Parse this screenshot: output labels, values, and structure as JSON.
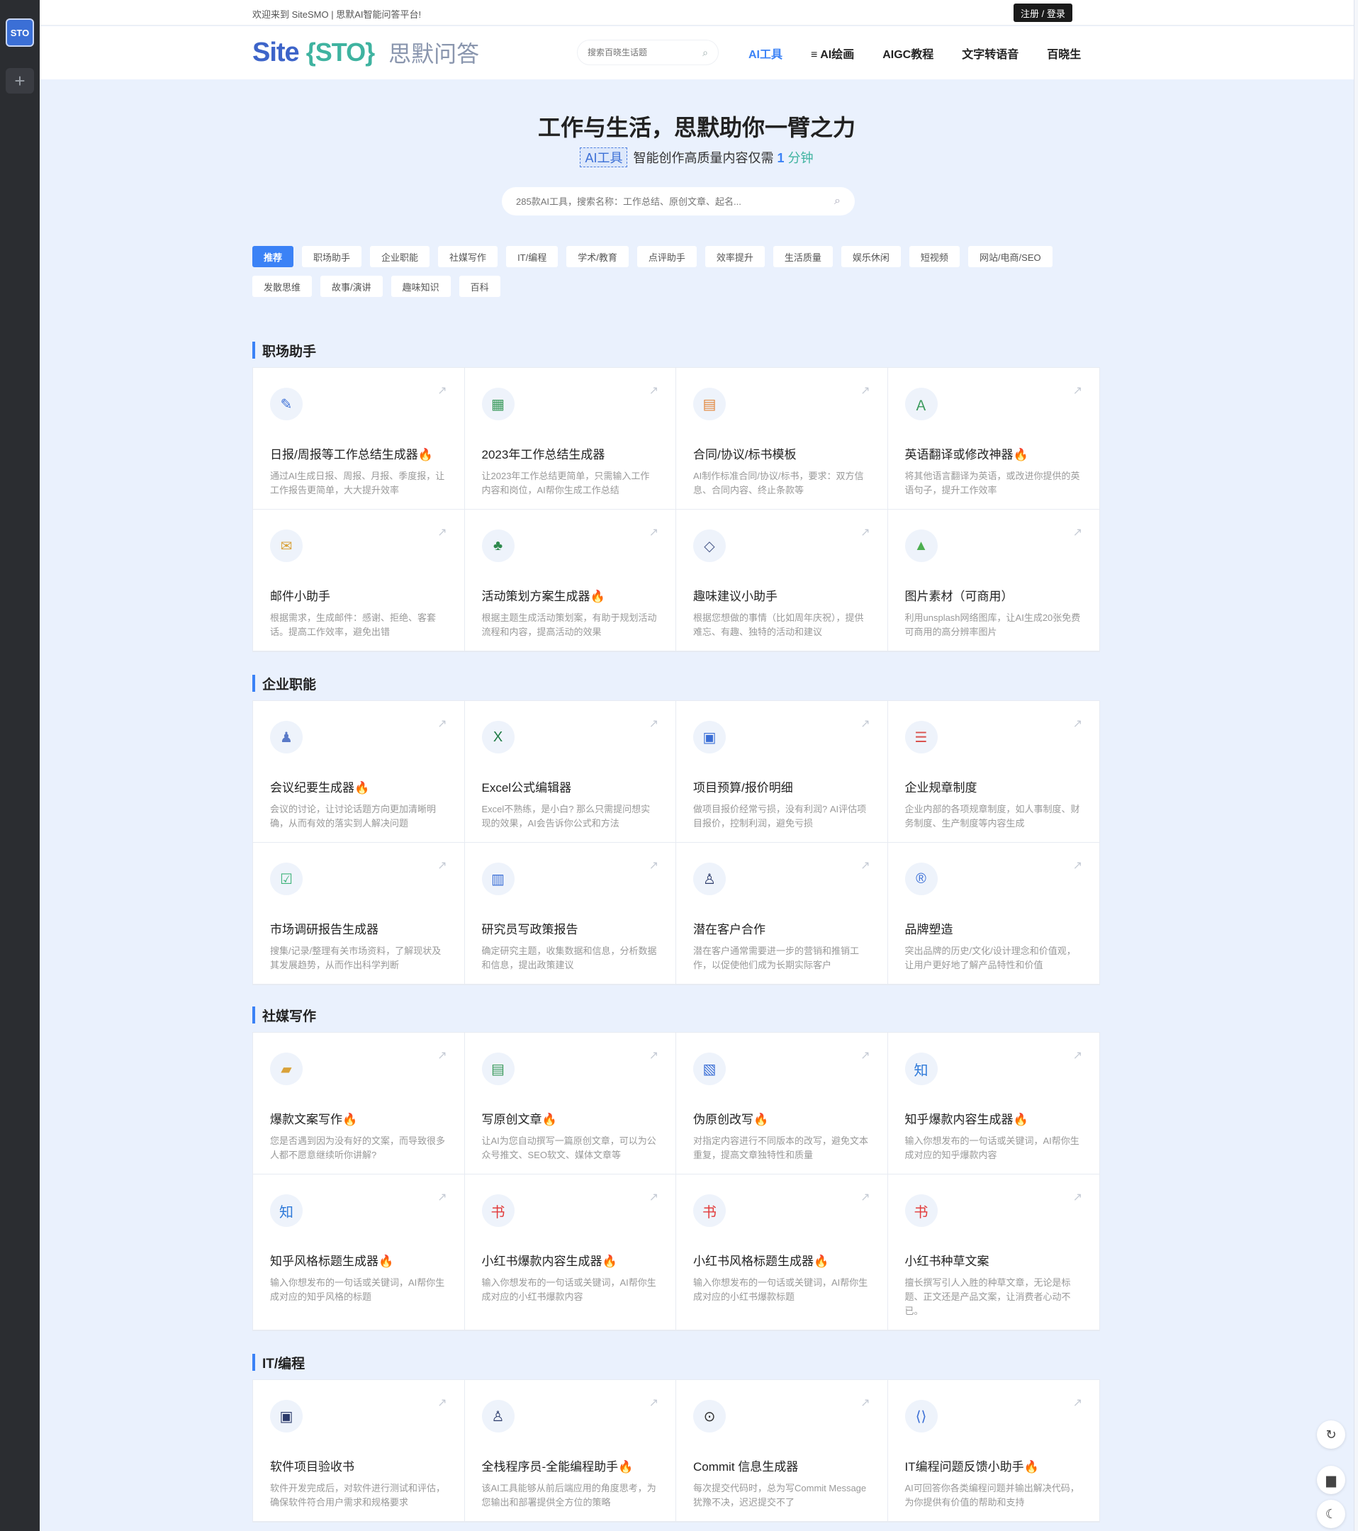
{
  "rail": {
    "logo_text": "STO",
    "add_icon": "plus-icon"
  },
  "topbar": {
    "welcome": "欢迎来到 SiteSMO | 思默AI智能问答平台!",
    "login": "注册 / 登录"
  },
  "header": {
    "logo_site": "Site",
    "logo_sto": "{STO}",
    "logo_cn": "思默问答",
    "search_placeholder": "搜索百晓生话题",
    "nav": [
      {
        "label": "AI工具",
        "active": true
      },
      {
        "label": "≡ AI绘画",
        "active": false
      },
      {
        "label": "AIGC教程",
        "active": false
      },
      {
        "label": "文字转语音",
        "active": false
      },
      {
        "label": "百晓生",
        "active": false
      }
    ]
  },
  "hero": {
    "title": "工作与生活，思默助你一臂之力",
    "tag": "AI工具",
    "sub_text": "智能创作高质量内容仅需",
    "sub_num": "1",
    "sub_unit": "分钟",
    "search_placeholder": "285款AI工具，搜索名称：工作总结、原创文章、起名..."
  },
  "chips": [
    "推荐",
    "职场助手",
    "企业职能",
    "社媒写作",
    "IT/编程",
    "学术/教育",
    "点评助手",
    "效率提升",
    "生活质量",
    "娱乐休闲",
    "短视频",
    "网站/电商/SEO",
    "发散思维",
    "故事/演讲",
    "趣味知识",
    "百科"
  ],
  "sections": [
    {
      "title": "职场助手",
      "cards": [
        {
          "icon": "edit-icon",
          "glyph": "✎",
          "color": "#3b6fd6",
          "title": "日报/周报等工作总结生成器",
          "hot": true,
          "desc": "通过AI生成日报、周报、月报、季度报，让工作报告更简单，大大提升效率"
        },
        {
          "icon": "calendar-icon",
          "glyph": "▦",
          "color": "#3a9a5b",
          "title": "2023年工作总结生成器",
          "hot": false,
          "desc": "让2023年工作总结更简单，只需输入工作内容和岗位，AI帮你生成工作总结"
        },
        {
          "icon": "contract-icon",
          "glyph": "▤",
          "color": "#e2853a",
          "title": "合同/协议/标书模板",
          "hot": false,
          "desc": "AI制作标准合同/协议/标书，要求：双方信息、合同内容、终止条款等"
        },
        {
          "icon": "translate-icon",
          "glyph": "Ａ",
          "color": "#3a9a5b",
          "title": "英语翻译或修改神器",
          "hot": true,
          "desc": "将其他语言翻译为英语，或改进你提供的英语句子，提升工作效率"
        },
        {
          "icon": "mail-icon",
          "glyph": "✉",
          "color": "#d9a23a",
          "title": "邮件小助手",
          "hot": false,
          "desc": "根据需求，生成邮件：感谢、拒绝、客套话。提高工作效率，避免出错"
        },
        {
          "icon": "tree-icon",
          "glyph": "♣",
          "color": "#2f8a4e",
          "title": "活动策划方案生成器",
          "hot": true,
          "desc": "根据主题生成活动策划案，有助于规划活动流程和内容，提高活动的效果"
        },
        {
          "icon": "eraser-icon",
          "glyph": "◇",
          "color": "#4a5a8a",
          "title": "趣味建议小助手",
          "hot": false,
          "desc": "根据您想做的事情（比如周年庆祝），提供难忘、有趣、独特的活动和建议"
        },
        {
          "icon": "image-icon",
          "glyph": "▲",
          "color": "#4caf50",
          "title": "图片素材（可商用）",
          "hot": false,
          "desc": "利用unsplash网络图库，让AI生成20张免费可商用的高分辨率图片"
        }
      ]
    },
    {
      "title": "企业职能",
      "cards": [
        {
          "icon": "meeting-icon",
          "glyph": "♟",
          "color": "#5a7ac8",
          "title": "会议纪要生成器",
          "hot": true,
          "desc": "会议的讨论，让讨论话题方向更加清晰明确，从而有效的落实到人解决问题"
        },
        {
          "icon": "excel-icon",
          "glyph": "X",
          "color": "#1e7a45",
          "title": "Excel公式编辑器",
          "hot": false,
          "desc": "Excel不熟练，是小白? 那么只需提问想实现的效果，AI会告诉你公式和方法"
        },
        {
          "icon": "budget-icon",
          "glyph": "▣",
          "color": "#3b6fd6",
          "title": "项目预算/报价明细",
          "hot": false,
          "desc": "做项目报价经常亏损，没有利润? AI评估项目报价，控制利润，避免亏损"
        },
        {
          "icon": "rules-icon",
          "glyph": "☰",
          "color": "#d9534f",
          "title": "企业规章制度",
          "hot": false,
          "desc": "企业内部的各项规章制度，如人事制度、财务制度、生产制度等内容生成"
        },
        {
          "icon": "survey-icon",
          "glyph": "☑",
          "color": "#3fb37a",
          "title": "市场调研报告生成器",
          "hot": false,
          "desc": "搜集/记录/整理有关市场资料，了解现状及其发展趋势，从而作出科学判断"
        },
        {
          "icon": "report-icon",
          "glyph": "▥",
          "color": "#3b6fd6",
          "title": "研究员写政策报告",
          "hot": false,
          "desc": "确定研究主题，收集数据和信息，分析数据和信息，提出政策建议"
        },
        {
          "icon": "customer-icon",
          "glyph": "♙",
          "color": "#2b3a6a",
          "title": "潜在客户合作",
          "hot": false,
          "desc": "潜在客户通常需要进一步的营销和推销工作，以促使他们成为长期实际客户"
        },
        {
          "icon": "brand-icon",
          "glyph": "®",
          "color": "#3b6fd6",
          "title": "品牌塑造",
          "hot": false,
          "desc": "突出品牌的历史/文化/设计理念和价值观，让用户更好地了解产品特性和价值"
        }
      ]
    },
    {
      "title": "社媒写作",
      "cards": [
        {
          "icon": "copy-icon",
          "glyph": "▰",
          "color": "#d9a23a",
          "title": "爆款文案写作",
          "hot": true,
          "desc": "您是否遇到因为没有好的文案，而导致很多人都不愿意继续听你讲解?"
        },
        {
          "icon": "document-icon",
          "glyph": "▤",
          "color": "#3a9a5b",
          "title": "写原创文章",
          "hot": true,
          "desc": "让AI为您自动撰写一篇原创文章，可以为公众号推文、SEO软文、媒体文章等"
        },
        {
          "icon": "rewrite-icon",
          "glyph": "▧",
          "color": "#3b6fd6",
          "title": "伪原创改写",
          "hot": true,
          "desc": "对指定内容进行不同版本的改写，避免文本重复，提高文章独特性和质量"
        },
        {
          "icon": "zhihu-icon",
          "glyph": "知",
          "color": "#2f7ad9",
          "title": "知乎爆款内容生成器",
          "hot": true,
          "desc": "输入你想发布的一句话或关键词，AI帮你生成对应的知乎爆款内容"
        },
        {
          "icon": "zhihu-title-icon",
          "glyph": "知",
          "color": "#2f7ad9",
          "title": "知乎风格标题生成器",
          "hot": true,
          "desc": "输入你想发布的一句话或关键词，AI帮你生成对应的知乎风格的标题"
        },
        {
          "icon": "xiaohongshu-icon",
          "glyph": "书",
          "color": "#e23b3b",
          "title": "小红书爆款内容生成器",
          "hot": true,
          "desc": "输入你想发布的一句话或关键词，AI帮你生成对应的小红书爆款内容"
        },
        {
          "icon": "xiaohongshu-title-icon",
          "glyph": "书",
          "color": "#e23b3b",
          "title": "小红书风格标题生成器",
          "hot": true,
          "desc": "输入你想发布的一句话或关键词，AI帮你生成对应的小红书爆款标题"
        },
        {
          "icon": "xiaohongshu-grass-icon",
          "glyph": "书",
          "color": "#e23b3b",
          "title": "小红书种草文案",
          "hot": false,
          "desc": "擅长撰写引人入胜的种草文章，无论是标题、正文还是产品文案，让消费者心动不已。"
        }
      ]
    },
    {
      "title": "IT/编程",
      "cards": [
        {
          "icon": "acceptance-icon",
          "glyph": "▣",
          "color": "#2b3a6a",
          "title": "软件项目验收书",
          "hot": false,
          "desc": "软件开发完成后，对软件进行测试和评估，确保软件符合用户需求和规格要求"
        },
        {
          "icon": "programmer-icon",
          "glyph": "♙",
          "color": "#2b3a6a",
          "title": "全栈程序员-全能编程助手",
          "hot": true,
          "desc": "该AI工具能够从前后端应用的角度思考，为您输出和部署提供全方位的策略"
        },
        {
          "icon": "commit-icon",
          "glyph": "⊙",
          "color": "#333333",
          "title": "Commit 信息生成器",
          "hot": false,
          "desc": "每次提交代码时，总为写Commit Message犹豫不决，迟迟提交不了"
        },
        {
          "icon": "code-icon",
          "glyph": "⟨⟩",
          "color": "#3b6fd6",
          "title": "IT编程问题反馈小助手",
          "hot": true,
          "desc": "AI可回答你各类编程问题并输出解决代码，为你提供有价值的帮助和支持"
        }
      ]
    }
  ],
  "fire_glyph": "🔥",
  "arrow_glyph": "↗",
  "float_buttons": [
    {
      "icon": "refresh-icon",
      "glyph": "↻"
    },
    {
      "icon": "bag-icon",
      "glyph": "▆"
    },
    {
      "icon": "moon-icon",
      "glyph": "☾"
    }
  ]
}
